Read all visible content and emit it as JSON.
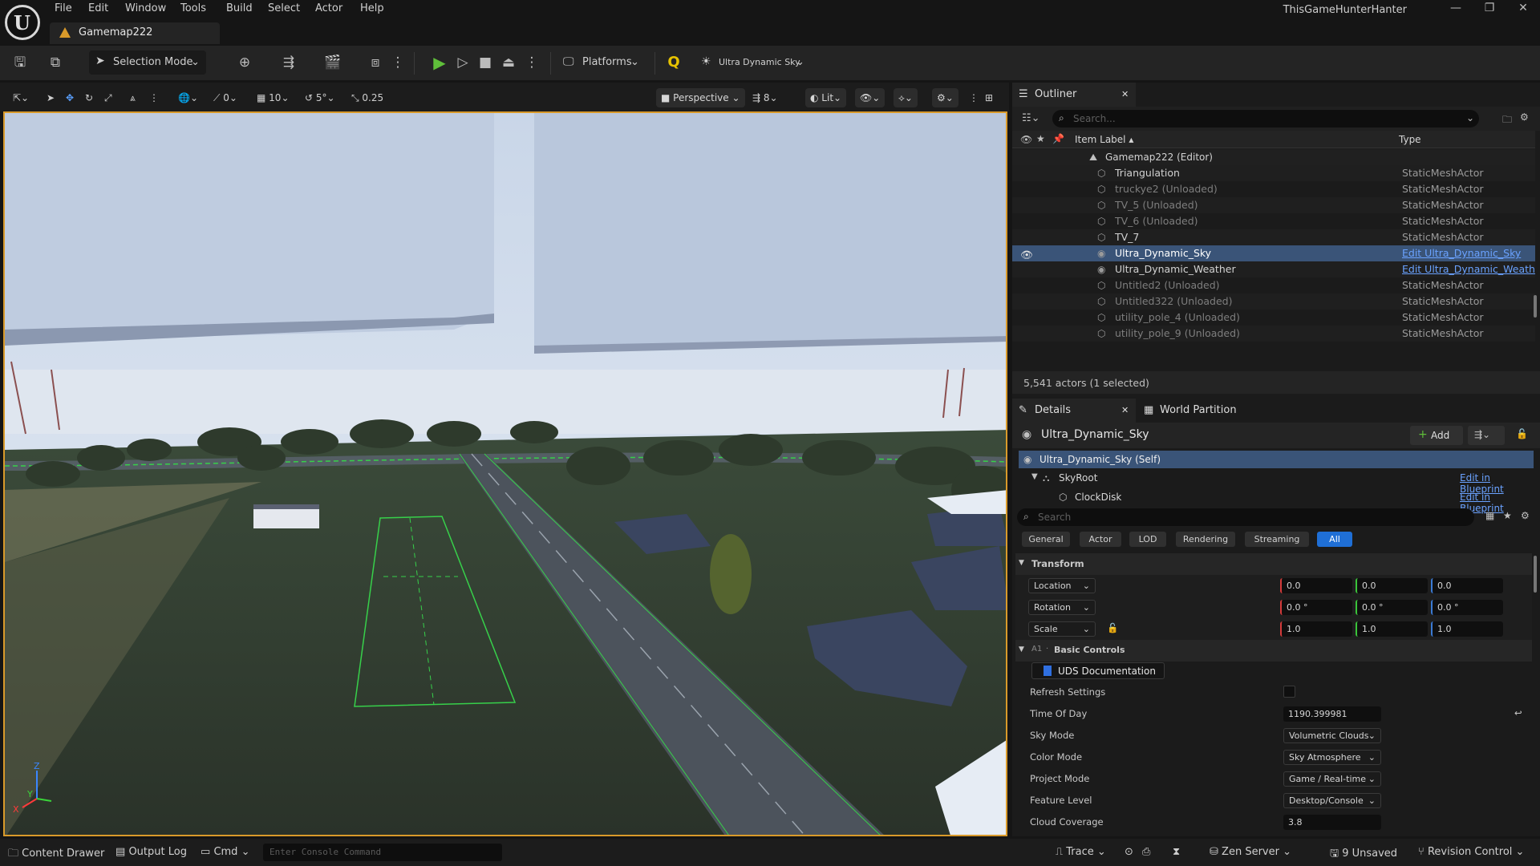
{
  "app": {
    "menu": [
      "File",
      "Edit",
      "Window",
      "Tools",
      "Build",
      "Select",
      "Actor",
      "Help"
    ],
    "document_tab": "Gamemap222",
    "window_title": "ThisGameHunterHanter"
  },
  "toolbar": {
    "mode": "Selection Mode",
    "platforms": "Platforms",
    "sky_preset": "Ultra Dynamic Sky"
  },
  "viewport_toolbar": {
    "rotation_snap_label": "0",
    "grid_snap": "10",
    "angle_snap": "5°",
    "scale_snap": "0.25",
    "view_mode": "Perspective",
    "camera_speed": "8",
    "lighting": "Lit"
  },
  "outliner": {
    "tab": "Outliner",
    "search_placeholder": "Search...",
    "col_label": "Item Label",
    "col_type": "Type",
    "root": "Gamemap222 (Editor)",
    "rows": [
      {
        "name": "Triangulation",
        "type": "StaticMeshActor",
        "unloaded": false,
        "selected": false,
        "link": false
      },
      {
        "name": "truckye2 (Unloaded)",
        "type": "StaticMeshActor",
        "unloaded": true,
        "selected": false,
        "link": false
      },
      {
        "name": "TV_5 (Unloaded)",
        "type": "StaticMeshActor",
        "unloaded": true,
        "selected": false,
        "link": false
      },
      {
        "name": "TV_6 (Unloaded)",
        "type": "StaticMeshActor",
        "unloaded": true,
        "selected": false,
        "link": false
      },
      {
        "name": "TV_7",
        "type": "StaticMeshActor",
        "unloaded": false,
        "selected": false,
        "link": false
      },
      {
        "name": "Ultra_Dynamic_Sky",
        "type": "Edit Ultra_Dynamic_Sky",
        "unloaded": false,
        "selected": true,
        "link": true
      },
      {
        "name": "Ultra_Dynamic_Weather",
        "type": "Edit Ultra_Dynamic_Weath",
        "unloaded": false,
        "selected": false,
        "link": true
      },
      {
        "name": "Untitled2 (Unloaded)",
        "type": "StaticMeshActor",
        "unloaded": true,
        "selected": false,
        "link": false
      },
      {
        "name": "Untitled322 (Unloaded)",
        "type": "StaticMeshActor",
        "unloaded": true,
        "selected": false,
        "link": false
      },
      {
        "name": "utility_pole_4 (Unloaded)",
        "type": "StaticMeshActor",
        "unloaded": true,
        "selected": false,
        "link": false
      },
      {
        "name": "utility_pole_9 (Unloaded)",
        "type": "StaticMeshActor",
        "unloaded": true,
        "selected": false,
        "link": false
      }
    ],
    "footer": "5,541 actors (1 selected)"
  },
  "details": {
    "tab": "Details",
    "tab2": "World Partition",
    "actor_name": "Ultra_Dynamic_Sky",
    "add_label": "Add",
    "components": [
      {
        "name": "Ultra_Dynamic_Sky (Self)",
        "action": ""
      },
      {
        "name": "SkyRoot",
        "action": "Edit in Blueprint"
      },
      {
        "name": "ClockDisk",
        "action": "Edit in Blueprint"
      }
    ],
    "search_placeholder": "Search",
    "categories": [
      "General",
      "Actor",
      "LOD",
      "Rendering",
      "Streaming",
      "All"
    ],
    "transform_header": "Transform",
    "location_label": "Location",
    "rotation_label": "Rotation",
    "scale_label": "Scale",
    "location": [
      "0.0",
      "0.0",
      "0.0"
    ],
    "rotation": [
      "0.0 °",
      "0.0 °",
      "0.0 °"
    ],
    "scale": [
      "1.0",
      "1.0",
      "1.0"
    ],
    "basic_controls_prefix": "A1",
    "basic_controls": "Basic Controls",
    "uds_doc": "UDS Documentation",
    "refresh_label": "Refresh Settings",
    "time_of_day_label": "Time Of Day",
    "time_of_day": "1190.399981",
    "sky_mode_label": "Sky Mode",
    "sky_mode": "Volumetric Clouds",
    "color_mode_label": "Color Mode",
    "color_mode": "Sky Atmosphere",
    "project_mode_label": "Project Mode",
    "project_mode": "Game / Real-time",
    "feature_level_label": "Feature Level",
    "feature_level": "Desktop/Console",
    "cloud_coverage_label": "Cloud Coverage",
    "cloud_coverage": "3.8"
  },
  "statusbar": {
    "content_drawer": "Content Drawer",
    "output_log": "Output Log",
    "cmd": "Cmd",
    "console_placeholder": "Enter Console Command",
    "trace": "Trace",
    "zen": "Zen Server",
    "unsaved": "9 Unsaved",
    "revision": "Revision Control"
  },
  "colors": {
    "accent": "#d99a2a",
    "selected_row": "#3a5478",
    "link": "#6aa2ff",
    "play_green": "#5fbf3a",
    "all_tab": "#1f6fd6"
  }
}
